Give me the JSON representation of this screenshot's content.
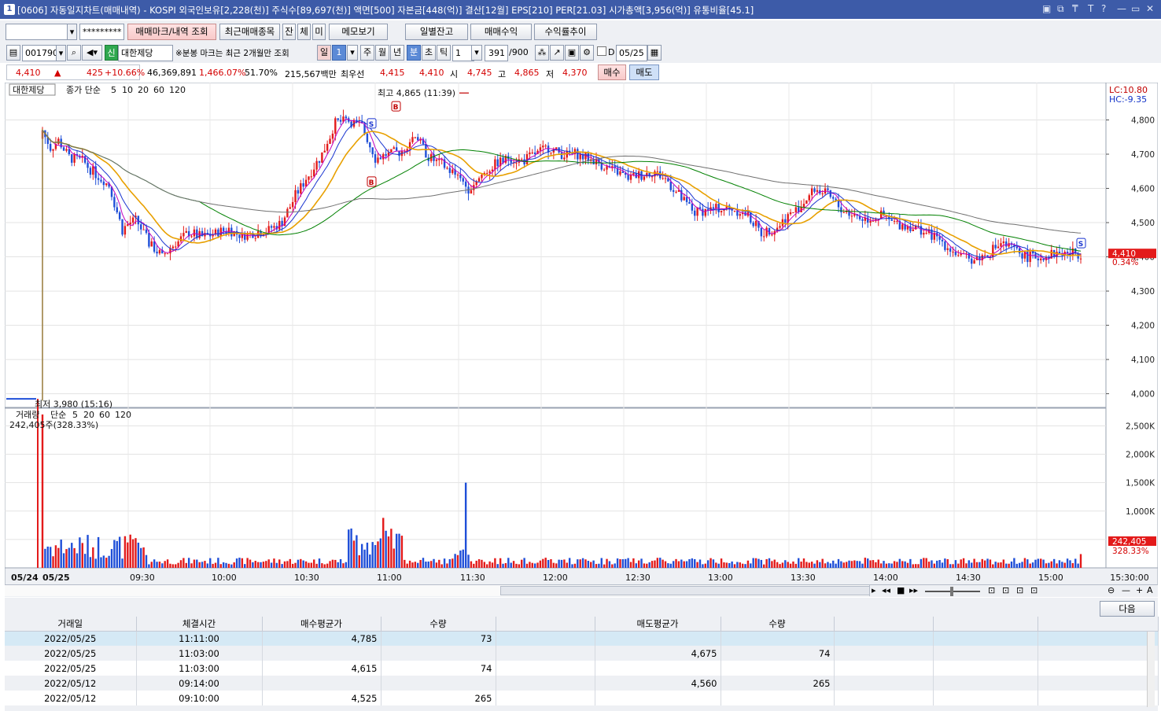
{
  "window": {
    "index": "1",
    "title": "[0606] 자동일지차트(매매내역) - KOSPI 외국인보유[2,228(천)] 주식수[89,697(천)] 액면[500] 자본금[448(억)] 결산[12월] EPS[210] PER[21.03] 시가총액[3,956(억)] 유통비율[45.1]",
    "controls": [
      "▣",
      "⧉",
      "₸",
      "T",
      "?",
      "—",
      "▭",
      "✕"
    ]
  },
  "toolbar1": {
    "account_value": "",
    "password_mask": "*********",
    "buttons": [
      "매매마크/내역 조회",
      "최근매매종목",
      "잔",
      "체",
      "미",
      "메모보기",
      "일별잔고",
      "매매수익",
      "수익률추이"
    ]
  },
  "toolbar2": {
    "code": "001790",
    "stock_name": "대한제당",
    "credit_badge": "신",
    "note": "※분봉 마크는 최근 2개월만 조회",
    "period_buttons": [
      "일",
      "주",
      "월",
      "년",
      "분",
      "초",
      "틱"
    ],
    "period_num": "1",
    "interval": "1",
    "count": "391",
    "count_max": "/900",
    "d_label": "D",
    "date": "05/25"
  },
  "quote": {
    "price": "4,410",
    "arrow": "▲",
    "change": "425",
    "change_pct": "+10.66%",
    "volume": "46,369,891",
    "volume_pct": "1,466.07%",
    "ratio": "51.70%",
    "amount": "215,567백만",
    "best_label": "최우선",
    "ask": "4,415",
    "bid": "4,410",
    "open_label": "시",
    "open": "4,745",
    "high_label": "고",
    "high": "4,865",
    "low_label": "저",
    "low": "4,370",
    "buy_btn": "매수",
    "sell_btn": "매도"
  },
  "chart_legend": {
    "name": "대한제당",
    "ma_label": "종가 단순",
    "ma_periods": [
      "5",
      "10",
      "20",
      "60",
      "120"
    ],
    "ma_colors": [
      "#c000c0",
      "#1a35d0",
      "#e8a000",
      "#008000",
      "#707070"
    ],
    "lc": "LC:10.80",
    "hc": "HC:-9.35",
    "high_annot": "최고 4,865 (11:39)",
    "low_annot": "최저 3,980 (15:16)",
    "last_price_box": "4,410",
    "last_pct": "0.34%",
    "vol_label": "거래량",
    "vol_ma_label": "단순",
    "vol_ma_periods": [
      "5",
      "20",
      "60",
      "120"
    ],
    "vol_current": "242,405주(328.33%)",
    "vol_box": "242,405",
    "vol_box_pct": "328.33%"
  },
  "chart_data": {
    "type": "candlestick",
    "price_axis": {
      "ticks": [
        "4,800",
        "4,700",
        "4,600",
        "4,500",
        "4,400",
        "4,300",
        "4,200",
        "4,100",
        "4,000"
      ],
      "range": [
        3960,
        4900
      ]
    },
    "volume_axis": {
      "ticks": [
        "2,500K",
        "2,000K",
        "1,500K",
        "1,000K",
        "500K"
      ],
      "range": [
        0,
        2700000
      ]
    },
    "x_axis": {
      "ticks": [
        "05/24",
        "05/25",
        "09:30",
        "10:00",
        "10:30",
        "11:00",
        "11:30",
        "12:00",
        "12:30",
        "13:00",
        "13:30",
        "14:00",
        "14:30",
        "15:00",
        "15:30:00"
      ]
    },
    "close_path": {
      "minutes": [
        0,
        1,
        3,
        6,
        10,
        15,
        20,
        25,
        30,
        35,
        40,
        45,
        50,
        55,
        60,
        65,
        70,
        75,
        80,
        85,
        90,
        95,
        100,
        105,
        110,
        115,
        120,
        125,
        130,
        135,
        140,
        145,
        150,
        155,
        160,
        165,
        170,
        175,
        180,
        185,
        190,
        195,
        200,
        205,
        210,
        215,
        220,
        225,
        230,
        235,
        240,
        245,
        250,
        255,
        260,
        265,
        270,
        275,
        280,
        285,
        290,
        295,
        300,
        305,
        310,
        315,
        320,
        325,
        330,
        335,
        340,
        345,
        350,
        355,
        360,
        365,
        370,
        375,
        380,
        385,
        390
      ],
      "prices": [
        4770,
        4750,
        4720,
        4740,
        4690,
        4680,
        4640,
        4610,
        4480,
        4510,
        4440,
        4400,
        4440,
        4470,
        4460,
        4470,
        4480,
        4460,
        4470,
        4480,
        4500,
        4580,
        4640,
        4700,
        4790,
        4800,
        4780,
        4690,
        4700,
        4710,
        4760,
        4690,
        4670,
        4640,
        4600,
        4640,
        4670,
        4690,
        4680,
        4700,
        4720,
        4700,
        4700,
        4690,
        4670,
        4650,
        4630,
        4640,
        4650,
        4620,
        4570,
        4530,
        4540,
        4540,
        4540,
        4520,
        4470,
        4480,
        4520,
        4550,
        4600,
        4580,
        4540,
        4520,
        4510,
        4520,
        4500,
        4490,
        4480,
        4460,
        4430,
        4400,
        4390,
        4410,
        4440,
        4420,
        4400,
        4400,
        4410,
        4410,
        4410
      ]
    },
    "volume_spikes": [
      {
        "x": "05/25 09:00",
        "value": 2700000
      },
      {
        "x": "11:39",
        "value": 1500000
      },
      {
        "x": "11:08",
        "value": 880000
      }
    ]
  },
  "scroll_controls": [
    "▸",
    "◂◂",
    "■",
    "▸▸",
    "⊡",
    "⊡",
    "⊡",
    "⊡",
    "⊖",
    "—",
    "+",
    "A"
  ],
  "panel": {
    "next_btn": "다음",
    "columns": [
      "거래일",
      "체결시간",
      "매수평균가",
      "수량",
      "",
      "매도평균가",
      "수량",
      "",
      "",
      ""
    ],
    "rows": [
      [
        "2022/05/25",
        "11:11:00",
        "4,785",
        "73",
        "",
        "",
        ""
      ],
      [
        "2022/05/25",
        "11:03:00",
        "",
        "",
        "",
        "4,675",
        "74"
      ],
      [
        "2022/05/25",
        "11:03:00",
        "4,615",
        "74",
        "",
        "",
        ""
      ],
      [
        "2022/05/12",
        "09:14:00",
        "",
        "",
        "",
        "4,560",
        "265"
      ],
      [
        "2022/05/12",
        "09:10:00",
        "4,525",
        "265",
        "",
        "",
        ""
      ]
    ]
  }
}
